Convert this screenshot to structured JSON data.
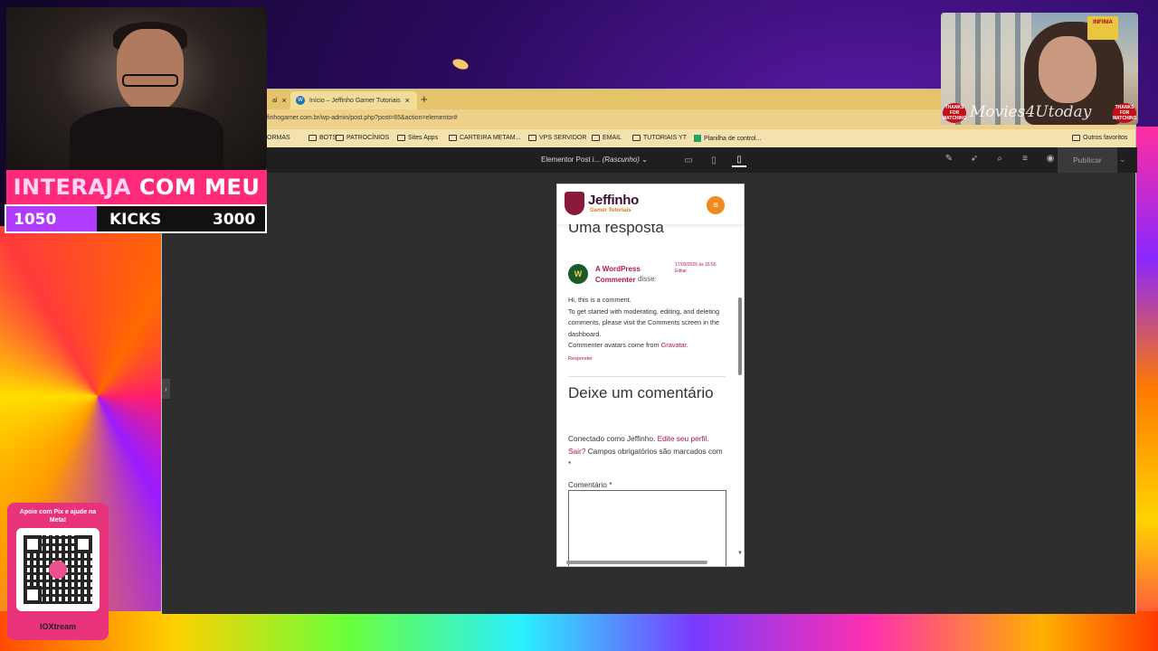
{
  "browser": {
    "tabs": [
      {
        "label": "al"
      },
      {
        "label": "Início – Jeffinho Gamer Tutoriais"
      }
    ],
    "url": "finhogamer.com.br/wp-admin/post.php?post=65&action=elementor#",
    "bookmarks": [
      {
        "label": "ORMAS",
        "icon": "none"
      },
      {
        "label": "BOTS",
        "icon": "folder-icon"
      },
      {
        "label": "PATROCÍNIOS",
        "icon": "folder-icon"
      },
      {
        "label": "Sites Apps",
        "icon": "folder-icon"
      },
      {
        "label": "CARTEIRA METAM...",
        "icon": "folder-icon"
      },
      {
        "label": "VPS SERVIDOR",
        "icon": "folder-icon"
      },
      {
        "label": "EMAIL",
        "icon": "folder-icon"
      },
      {
        "label": "TUTORIAIS YT",
        "icon": "folder-icon"
      },
      {
        "label": "Planilha de control...",
        "icon": "sheets-icon"
      },
      {
        "label": "Outros favoritos",
        "icon": "folder-icon"
      }
    ]
  },
  "editor": {
    "doc_title": "Elementor Post i...",
    "doc_status": "(Rascunho)",
    "publish_label": "Publicar"
  },
  "preview": {
    "site_name": "Jeffinho",
    "site_tagline": "Gamer Tutoriais",
    "responses_heading": "Uma resposta",
    "comment": {
      "author": "A WordPress Commenter",
      "says": "disse:",
      "date": "17/03/2026 às 16:56",
      "edit": "Editar",
      "line1": "Hi, this is a comment.",
      "line2": "To get started with moderating, editing, and deleting comments, please visit the Comments screen in the dashboard.",
      "line3_prefix": "Commenter avatars come from",
      "line3_link": "Gravatar",
      "line3_suffix": ".",
      "reply": "Responder"
    },
    "leave_heading": "Deixe um comentário",
    "logged_prefix": "Conectado como Jeffinho.",
    "edit_profile": "Edite seu perfil",
    "logout": "Sair?",
    "required_note": "Campos obrigatórios são marcados com *",
    "comment_label": "Comentário *"
  },
  "overlay": {
    "banner_part1": "INTERAJA",
    "banner_part2": "COM MEU",
    "progress_current": "1050",
    "progress_label": "KICKS",
    "progress_goal": "3000",
    "progress_fraction": 0.35,
    "pix_title": "Apoie com Pix e ajude na Meta!",
    "pix_brand": "IOXtream",
    "cam_right_sign": "INFINIA",
    "cam_right_watermark": "Movies4Utoday",
    "thanks_badge": "THANKS FOR WATCHING"
  }
}
